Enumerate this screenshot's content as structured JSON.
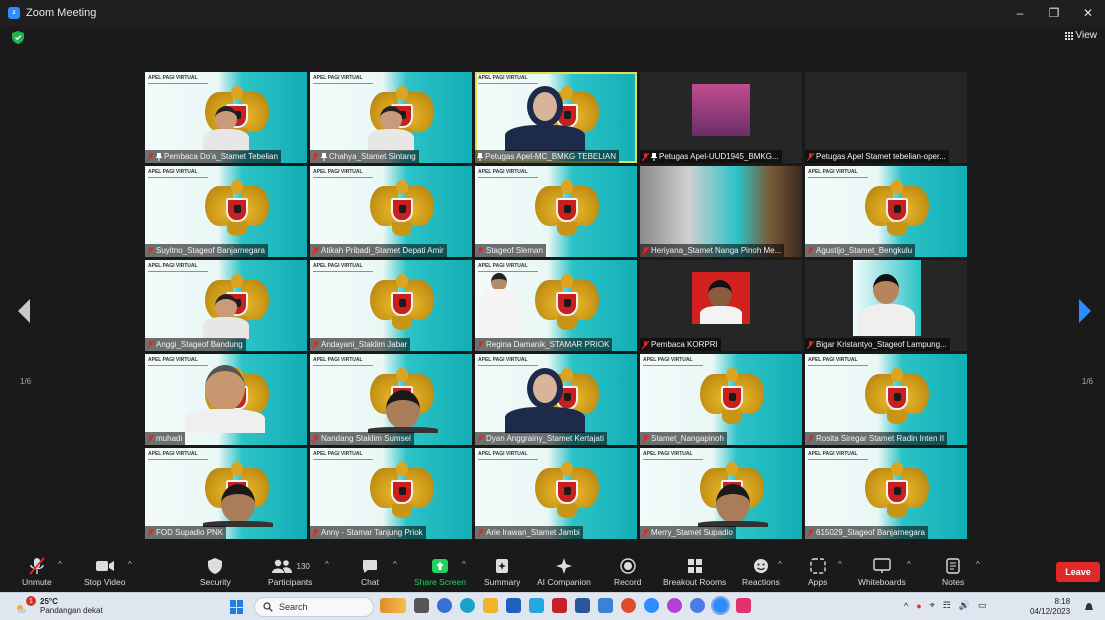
{
  "window": {
    "title": "Zoom Meeting"
  },
  "view_button": "View",
  "tiles": [
    {
      "name": "Pembaca Do'a_Stamet Tebelian",
      "muted": true,
      "pinned": true,
      "kind": "person",
      "banner": true
    },
    {
      "name": "Chahya_Stamet Sintang",
      "muted": true,
      "pinned": true,
      "kind": "person",
      "banner": true
    },
    {
      "name": "Petugas Apel-MC_BMKG TEBELIAN",
      "muted": false,
      "pinned": true,
      "kind": "person-hijab",
      "banner": true,
      "active": true
    },
    {
      "name": "Petugas Apel-UUD1945_BMKG...",
      "muted": true,
      "pinned": true,
      "kind": "dark-thumb"
    },
    {
      "name": "Petugas Apel Stamet tebelian-oper...",
      "muted": true,
      "pinned": false,
      "kind": "dark"
    },
    {
      "name": "Suyitno_Stageof Banjarnegara",
      "muted": true,
      "pinned": false,
      "kind": "garuda",
      "banner": true
    },
    {
      "name": "Atikah Pribadi_Stamet Depati Amir",
      "muted": true,
      "pinned": false,
      "kind": "garuda",
      "banner": true
    },
    {
      "name": "Stageof Sleman",
      "muted": true,
      "pinned": false,
      "kind": "garuda",
      "banner": true
    },
    {
      "name": "Heriyana_Stamet Nanga Pinoh Me...",
      "muted": true,
      "pinned": false,
      "kind": "room",
      "banner": true
    },
    {
      "name": "Agustijo_Stamet_Bengkulu",
      "muted": true,
      "pinned": false,
      "kind": "garuda",
      "banner": true
    },
    {
      "name": "Anggi_Stageof Bandung",
      "muted": true,
      "pinned": false,
      "kind": "person",
      "banner": true
    },
    {
      "name": "Andayani_Staklim Jabar",
      "muted": true,
      "pinned": false,
      "kind": "garuda",
      "banner": true
    },
    {
      "name": "Regina Damanik_STAMAR PRIOK",
      "muted": true,
      "pinned": false,
      "kind": "person-white",
      "banner": true
    },
    {
      "name": "Pembaca KORPRI",
      "muted": true,
      "pinned": false,
      "kind": "dark-thumb-red"
    },
    {
      "name": "Bigar Kristantyo_Stageof Lampung...",
      "muted": true,
      "pinned": false,
      "kind": "dark-thumb-garuda"
    },
    {
      "name": "muhadi",
      "muted": true,
      "pinned": false,
      "kind": "person-close",
      "banner": true
    },
    {
      "name": "Nandang Staklim Sumsel",
      "muted": true,
      "pinned": false,
      "kind": "person-low",
      "banner": true
    },
    {
      "name": "Dyan Anggrainy_Stamet Kertajati",
      "muted": true,
      "pinned": false,
      "kind": "person-hijab",
      "banner": true
    },
    {
      "name": "Stamet_Nangapinoh",
      "muted": true,
      "pinned": false,
      "kind": "garuda",
      "banner": true
    },
    {
      "name": "Rosita Siregar Stamet Radin Inten II",
      "muted": true,
      "pinned": false,
      "kind": "garuda",
      "banner": true
    },
    {
      "name": "FOD Supadio PNK",
      "muted": true,
      "pinned": false,
      "kind": "person-low",
      "banner": true
    },
    {
      "name": "Anny - Stamar Tanjung Priok",
      "muted": true,
      "pinned": false,
      "kind": "garuda",
      "banner": true
    },
    {
      "name": "Arie Irawan_Stamet Jambi",
      "muted": true,
      "pinned": false,
      "kind": "garuda",
      "banner": true
    },
    {
      "name": "Merry_Stamet Supadio",
      "muted": true,
      "pinned": false,
      "kind": "person-low",
      "banner": true
    },
    {
      "name": "615029_Stageof Banjarnegara",
      "muted": true,
      "pinned": false,
      "kind": "garuda",
      "banner": true
    }
  ],
  "banner_text": "APEL PAGI VIRTUAL",
  "pager": {
    "left": "1/6",
    "right": "1/6"
  },
  "toolbar": {
    "unmute": "Unmute",
    "stop_video": "Stop Video",
    "security": "Security",
    "participants": "Participants",
    "participant_count": "130",
    "chat": "Chat",
    "share_screen": "Share Screen",
    "summary": "Summary",
    "ai_companion": "AI Companion",
    "record": "Record",
    "breakout_rooms": "Breakout Rooms",
    "reactions": "Reactions",
    "apps": "Apps",
    "whiteboards": "Whiteboards",
    "notes": "Notes",
    "leave": "Leave"
  },
  "taskbar": {
    "temp": "25°C",
    "weather_text": "Pandangan dekat",
    "weather_badge": "1",
    "search": "Search",
    "time": "8:18",
    "date": "04/12/2023"
  },
  "colors": {
    "accent": "#2d8cff",
    "leave": "#e02828",
    "share": "#23d160",
    "tile_teal": "#12aeb5"
  }
}
